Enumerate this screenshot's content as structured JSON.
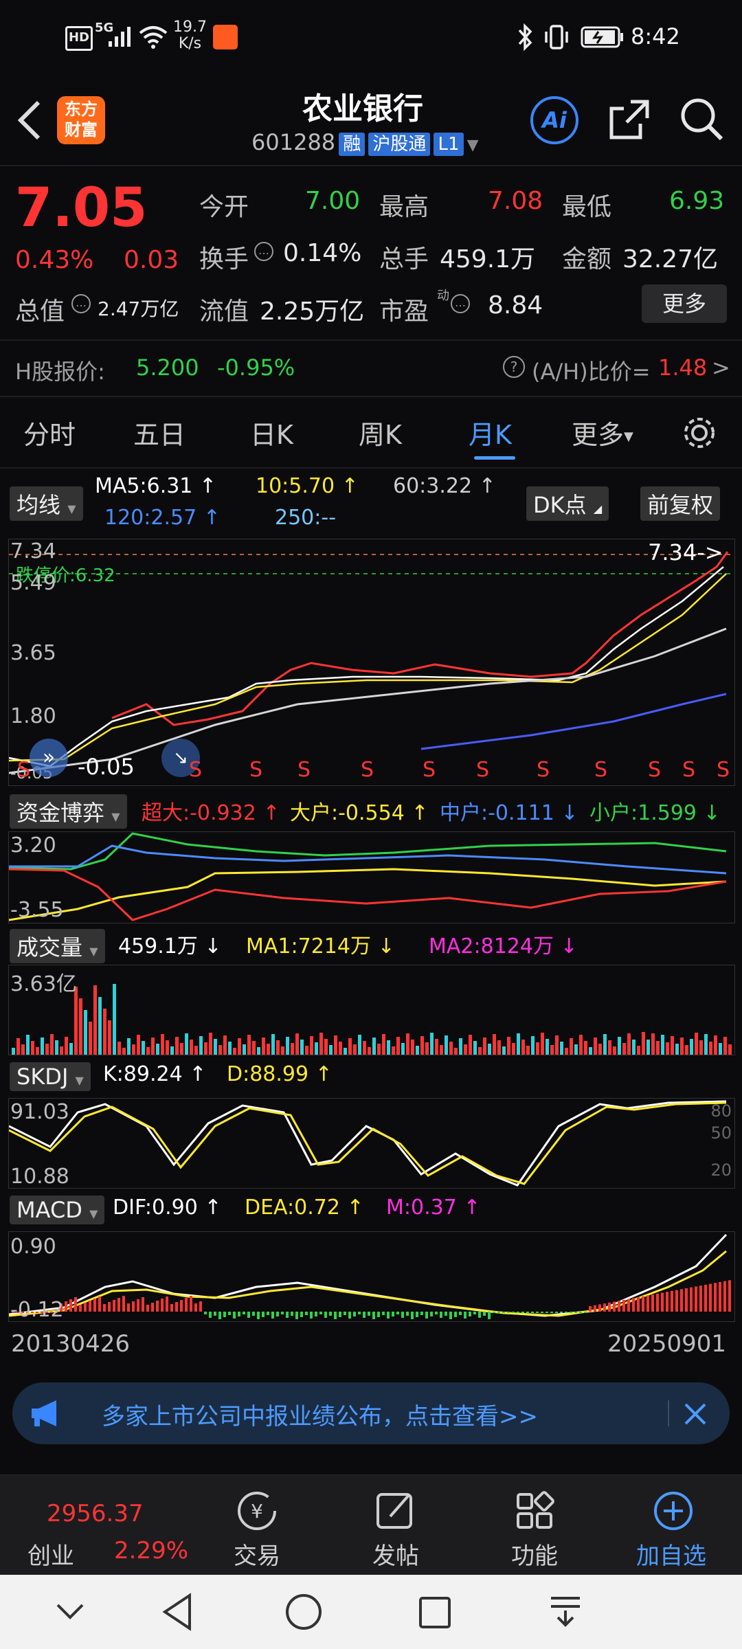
{
  "status_bar": {
    "speed_value": "19.7",
    "speed_unit": "K/s",
    "time": "8:42",
    "net": "5G",
    "hd": "HD"
  },
  "header": {
    "logo_line1": "东方",
    "logo_line2": "财富",
    "title": "农业银行",
    "code": "601288",
    "tags": [
      "融",
      "沪股通",
      "L1"
    ],
    "ai_label": "Ai"
  },
  "quote": {
    "price": "7.05",
    "change_pct": "0.43%",
    "change": "0.03",
    "open_label": "今开",
    "open": "7.00",
    "high_label": "最高",
    "high": "7.08",
    "low_label": "最低",
    "low": "6.93",
    "turnover_label": "换手",
    "turnover": "0.14%",
    "volume_label": "总手",
    "volume": "459.1万",
    "amount_label": "金额",
    "amount": "32.27亿",
    "mktcap_label": "总值",
    "mktcap": "2.47万亿",
    "float_label": "流值",
    "float": "2.25万亿",
    "pe_label": "市盈",
    "pe_sup": "动",
    "pe": "8.84",
    "more_button": "更多"
  },
  "hshare": {
    "label": "H股报价:",
    "price": "5.200",
    "pct": "-0.95%",
    "ratio_label": "(A/H)比价=",
    "ratio": "1.48",
    "arrow": ">"
  },
  "tabs": [
    "分时",
    "五日",
    "日K",
    "周K",
    "月K",
    "更多"
  ],
  "active_tab": "月K",
  "ma_bar": {
    "chip": "均线",
    "ma5": "MA5:6.31 ↑",
    "ma10": "10:5.70 ↑",
    "ma60": "60:3.22 ↑",
    "ma120": "120:2.57 ↑",
    "ma250": "250:--",
    "dk_button": "DK点",
    "fq_button": "前复权"
  },
  "main_chart": {
    "y_labels": [
      "7.34",
      "5.49",
      "3.65",
      "1.80",
      "-0.05"
    ],
    "limit_label": "跌停价:6.32",
    "last_marker": "7.34->",
    "low_marker": "-0.05",
    "signal": "S"
  },
  "fund_flow": {
    "chip": "资金博弈",
    "super": "超大:-0.932 ↑",
    "large": "大户:-0.554 ↑",
    "medium": "中户:-0.111 ↓",
    "small": "小户:1.599 ↓",
    "y_top": "3.20",
    "y_bottom": "-3.55"
  },
  "volume_panel": {
    "chip": "成交量",
    "vol": "459.1万 ↓",
    "ma1": "MA1:7214万 ↓",
    "ma2": "MA2:8124万 ↓",
    "y_top": "3.63亿"
  },
  "skdj": {
    "chip": "SKDJ",
    "k": "K:89.24 ↑",
    "d": "D:88.99 ↑",
    "y_top": "91.03",
    "y_bottom": "10.88",
    "r80": "80",
    "r50": "50",
    "r20": "20"
  },
  "macd": {
    "chip": "MACD",
    "dif": "DIF:0.90 ↑",
    "dea": "DEA:0.72 ↑",
    "m": "M:0.37 ↑",
    "y_top": "0.90",
    "y_bottom": "-0.12"
  },
  "date_axis": {
    "start": "20130426",
    "end": "20250901"
  },
  "banner": {
    "text": "多家上市公司中报业绩公布，点击查看>>"
  },
  "bottom_nav": {
    "index_value": "2956.37",
    "index_name": "创业",
    "index_pct": "2.29%",
    "items": [
      "交易",
      "发帖",
      "功能",
      "加自选"
    ]
  },
  "colors": {
    "up": "#ff3434",
    "down": "#31d24a",
    "accent": "#4d9bff",
    "yellow": "#ffe930",
    "magenta": "#ff2fe0"
  }
}
